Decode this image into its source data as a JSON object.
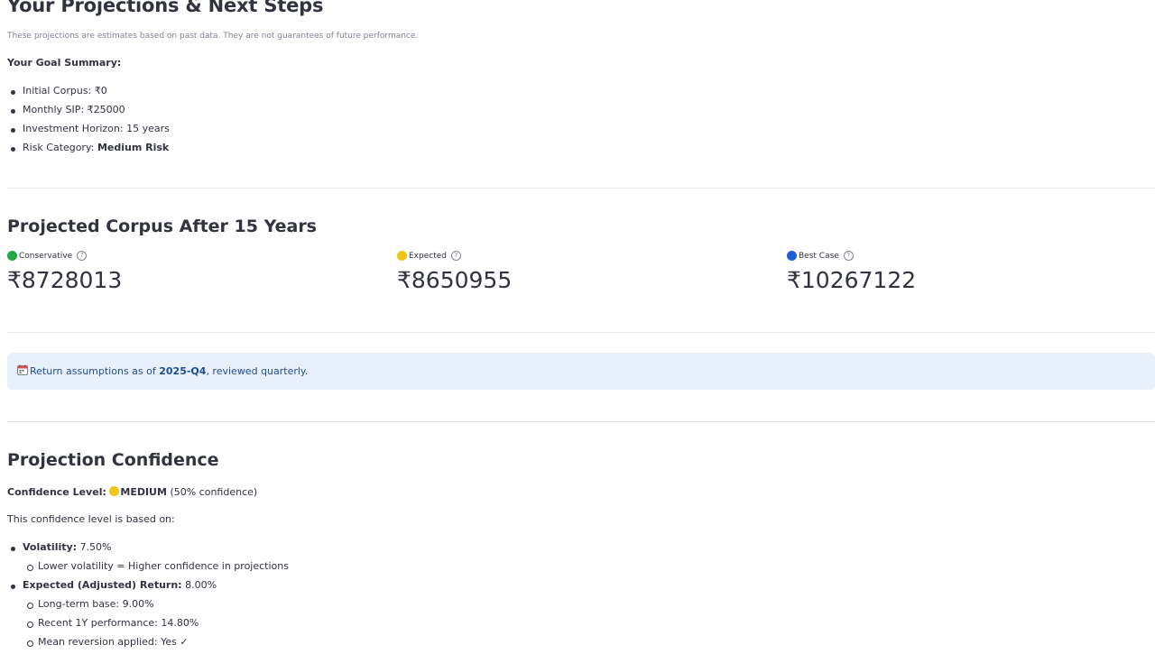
{
  "header": {
    "title": "Your Projections & Next Steps",
    "disclaimer": "These projections are estimates based on past data. They are not guarantees of future performance."
  },
  "goal_summary": {
    "heading": "Your Goal Summary:",
    "items": [
      {
        "label": "Initial Corpus:",
        "value": "₹0"
      },
      {
        "label": "Monthly SIP:",
        "value": "₹25000"
      },
      {
        "label": "Investment Horizon:",
        "value": "15 years"
      },
      {
        "label": "Risk Category:",
        "value": "Medium Risk"
      }
    ]
  },
  "projected": {
    "heading": "Projected Corpus After 15 Years",
    "metrics": [
      {
        "label": "Conservative",
        "value": "₹8728013",
        "dot_color": "#22a845",
        "help": "?"
      },
      {
        "label": "Expected",
        "value": "₹8650955",
        "dot_color": "#f2c318",
        "help": "?"
      },
      {
        "label": "Best Case",
        "value": "₹10267122",
        "dot_color": "#1f5fd6",
        "help": "?"
      }
    ]
  },
  "info_alert": {
    "icon": "calendar-icon",
    "prefix": "Return assumptions as of ",
    "quarter": "2025-Q4",
    "suffix": ", reviewed quarterly."
  },
  "confidence": {
    "heading": "Projection Confidence",
    "level_label": "Confidence Level:",
    "level_value": "MEDIUM",
    "level_note": "(50% confidence)",
    "level_dot_color": "#f2c318",
    "based_on": "This confidence level is based on:",
    "volatility_label": "Volatility:",
    "volatility_value": "7.50%",
    "volatility_note": "Lower volatility = Higher confidence in projections",
    "return_label": "Expected (Adjusted) Return:",
    "return_value": "8.00%",
    "return_notes": [
      "Long-term base: 9.00%",
      "Recent 1Y performance: 14.80%",
      "Mean reversion applied: Yes ✓"
    ]
  }
}
